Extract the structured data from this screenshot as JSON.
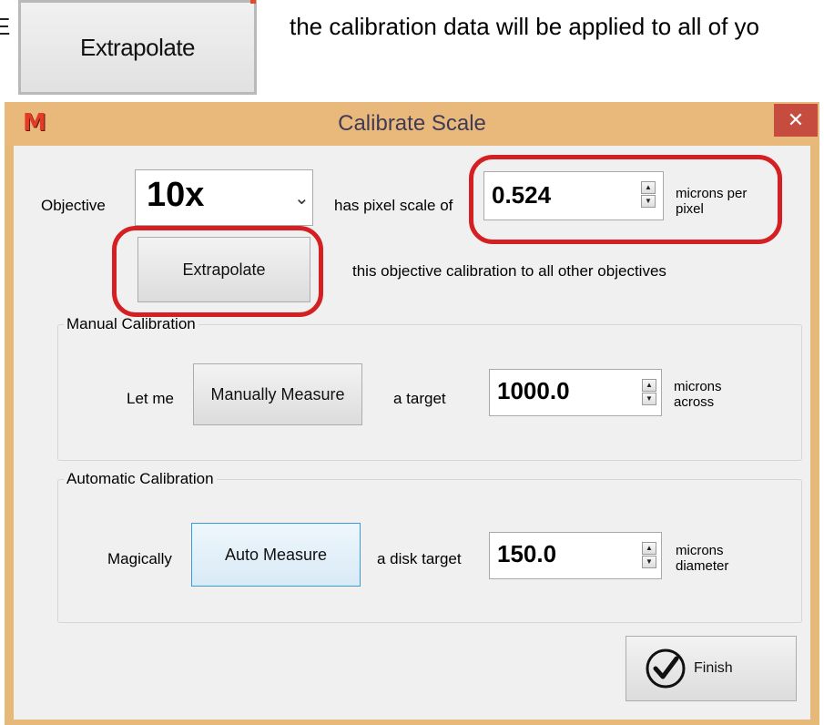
{
  "doc": {
    "left_glyph": "E",
    "button_label": "Extrapolate",
    "sentence": "the calibration data will be applied to all of yo"
  },
  "dialog": {
    "title": "Calibrate Scale",
    "close_glyph": "✕",
    "app_icon_glyph": "M",
    "objective": {
      "label": "Objective",
      "value": "10x",
      "dropdown_glyph": "⌄",
      "scale_label": "has pixel scale of",
      "scale_value": "0.524",
      "scale_unit_line1": "microns per",
      "scale_unit_line2": "pixel"
    },
    "extrapolate": {
      "button_label": "Extrapolate",
      "description": "this objective calibration to all other objectives"
    },
    "manual": {
      "group_title": "Manual Calibration",
      "prefix": "Let me",
      "button_label": "Manually Measure",
      "middle": "a target",
      "value": "1000.0",
      "unit_line1": "microns",
      "unit_line2": "across"
    },
    "automatic": {
      "group_title": "Automatic Calibration",
      "prefix": "Magically",
      "button_label": "Auto Measure",
      "middle": "a disk target",
      "value": "150.0",
      "unit_line1": "microns",
      "unit_line2": "diameter"
    },
    "finish": {
      "button_label": "Finish"
    },
    "spin_up": "▲",
    "spin_down": "▼"
  },
  "colors": {
    "titlebar": "#e9b97c",
    "annotation_red": "#d42022",
    "close_button": "#c74c40"
  }
}
